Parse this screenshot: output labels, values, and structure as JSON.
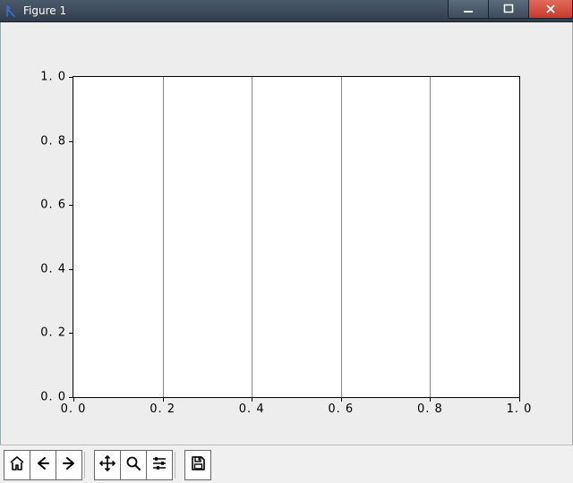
{
  "window": {
    "title": "Figure 1"
  },
  "chart_data": {
    "type": "line",
    "series": [],
    "x_ticks": [
      0.0,
      0.2,
      0.4,
      0.6,
      0.8,
      1.0
    ],
    "y_ticks": [
      0.0,
      0.2,
      0.4,
      0.6,
      0.8,
      1.0
    ],
    "x_tick_labels": [
      "0. 0",
      "0. 2",
      "0. 4",
      "0. 6",
      "0. 8",
      "1. 0"
    ],
    "y_tick_labels": [
      "0. 0",
      "0. 2",
      "0. 4",
      "0. 6",
      "0. 8",
      "1. 0"
    ],
    "xlim": [
      0.0,
      1.0
    ],
    "ylim": [
      0.0,
      1.0
    ],
    "grid": "x",
    "title": "",
    "xlabel": "",
    "ylabel": ""
  },
  "toolbar": {
    "home": "Home",
    "back": "Back",
    "forward": "Forward",
    "pan": "Pan",
    "zoom": "Zoom",
    "configure": "Configure subplots",
    "save": "Save"
  }
}
